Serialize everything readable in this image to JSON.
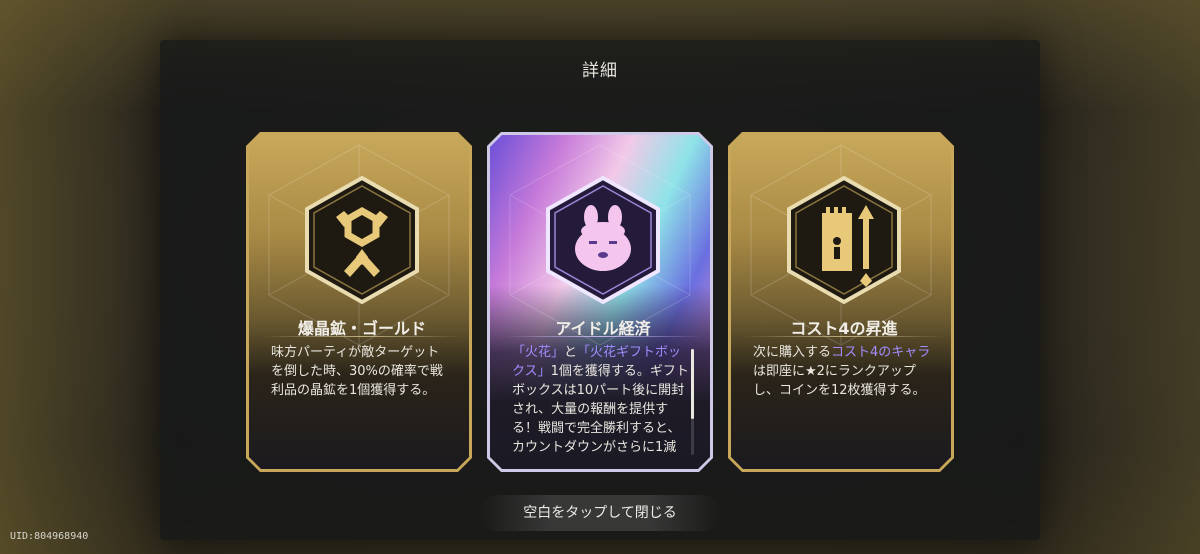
{
  "dialog": {
    "title": "詳細"
  },
  "cards": [
    {
      "name": "爆晶鉱・ゴールド",
      "icon": "ore-crossed-swords-icon",
      "style": "gold",
      "description_parts": [
        {
          "text": "味方パーティが敵ターゲットを倒した時、30%の確率で戦利品の晶鉱を1個獲得する。",
          "highlight": false
        }
      ]
    },
    {
      "name": "アイドル経済",
      "icon": "idol-mascot-icon",
      "style": "rainbow",
      "description_parts": [
        {
          "text": "「火花」",
          "highlight": true
        },
        {
          "text": "と",
          "highlight": false
        },
        {
          "text": "「火花ギフトボックス」",
          "highlight": true
        },
        {
          "text": "1個を獲得する。ギフトボックスは10パート後に開封され、大量の報酬を提供する！戦闘で完全勝利すると、カウントダウンがさらに1減",
          "highlight": false
        }
      ]
    },
    {
      "name": "コスト4の昇進",
      "icon": "rank-up-scroll-icon",
      "style": "gold",
      "description_parts": [
        {
          "text": "次に購入する",
          "highlight": false
        },
        {
          "text": "コスト4のキャラ",
          "highlight": true
        },
        {
          "text": "は即座に★2にランクアップし、コインを12枚獲得する。",
          "highlight": false
        }
      ]
    }
  ],
  "close_hint": "空白をタップして閉じる",
  "uid": "UID:804968940",
  "colors": {
    "gold": "#c9a75a",
    "highlight": "#a28cff",
    "panel": "#141618"
  }
}
